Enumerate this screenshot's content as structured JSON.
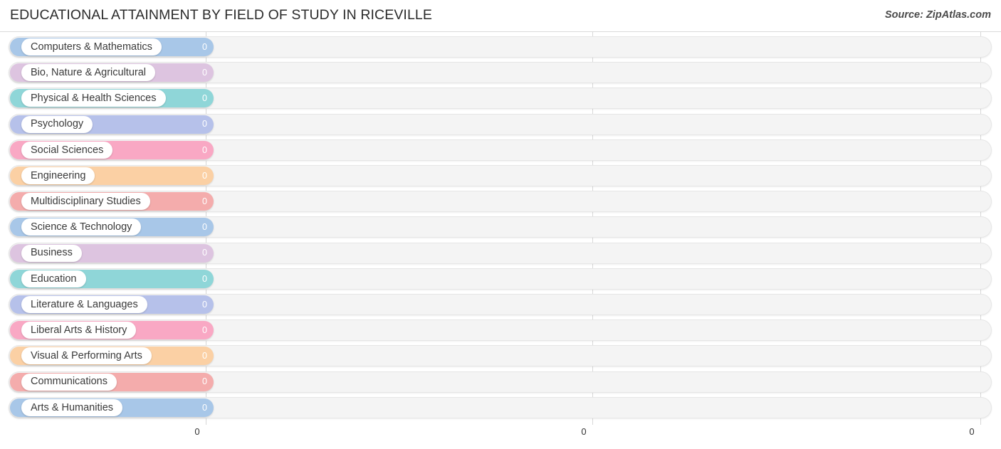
{
  "header": {
    "title": "EDUCATIONAL ATTAINMENT BY FIELD OF STUDY IN RICEVILLE",
    "source": "Source: ZipAtlas.com"
  },
  "chart_data": {
    "type": "bar",
    "orientation": "horizontal",
    "title": "EDUCATIONAL ATTAINMENT BY FIELD OF STUDY IN RICEVILLE",
    "xlabel": "",
    "ylabel": "",
    "xlim": [
      0,
      0
    ],
    "grid": true,
    "legend": "none",
    "axis_ticks": [
      "0",
      "0",
      "0"
    ],
    "categories": [
      "Computers & Mathematics",
      "Bio, Nature & Agricultural",
      "Physical & Health Sciences",
      "Psychology",
      "Social Sciences",
      "Engineering",
      "Multidisciplinary Studies",
      "Science & Technology",
      "Business",
      "Education",
      "Literature & Languages",
      "Liberal Arts & History",
      "Visual & Performing Arts",
      "Communications",
      "Arts & Humanities"
    ],
    "values": [
      0,
      0,
      0,
      0,
      0,
      0,
      0,
      0,
      0,
      0,
      0,
      0,
      0,
      0,
      0
    ],
    "value_labels": [
      "0",
      "0",
      "0",
      "0",
      "0",
      "0",
      "0",
      "0",
      "0",
      "0",
      "0",
      "0",
      "0",
      "0",
      "0"
    ],
    "colors": [
      "#a8c7e8",
      "#ddc4e0",
      "#8fd6d8",
      "#b6c1ea",
      "#f9a8c4",
      "#fbd0a4",
      "#f4acac",
      "#a8c7e8",
      "#ddc4e0",
      "#8fd6d8",
      "#b6c1ea",
      "#f9a8c4",
      "#fbd0a4",
      "#f4acac",
      "#a8c7e8"
    ]
  }
}
